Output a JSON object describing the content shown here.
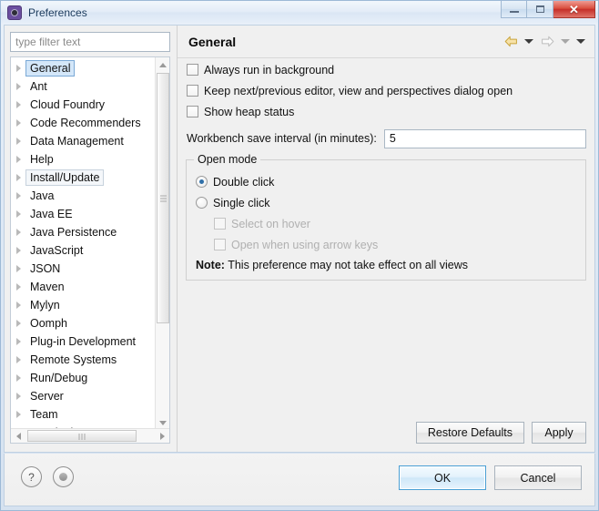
{
  "window": {
    "title": "Preferences",
    "icon": "preferences-gear-icon",
    "controls": {
      "minimize": "minimize-icon",
      "maximize": "maximize-icon",
      "close": "✕"
    }
  },
  "sidebar": {
    "filter": {
      "placeholder": "type filter text",
      "value": ""
    },
    "items": [
      {
        "label": "General",
        "state": "selected"
      },
      {
        "label": "Ant",
        "state": "normal"
      },
      {
        "label": "Cloud Foundry",
        "state": "normal"
      },
      {
        "label": "Code Recommenders",
        "state": "normal"
      },
      {
        "label": "Data Management",
        "state": "normal"
      },
      {
        "label": "Help",
        "state": "normal"
      },
      {
        "label": "Install/Update",
        "state": "hovered"
      },
      {
        "label": "Java",
        "state": "normal"
      },
      {
        "label": "Java EE",
        "state": "normal"
      },
      {
        "label": "Java Persistence",
        "state": "normal"
      },
      {
        "label": "JavaScript",
        "state": "normal"
      },
      {
        "label": "JSON",
        "state": "normal"
      },
      {
        "label": "Maven",
        "state": "normal"
      },
      {
        "label": "Mylyn",
        "state": "normal"
      },
      {
        "label": "Oomph",
        "state": "normal"
      },
      {
        "label": "Plug-in Development",
        "state": "normal"
      },
      {
        "label": "Remote Systems",
        "state": "normal"
      },
      {
        "label": "Run/Debug",
        "state": "normal"
      },
      {
        "label": "Server",
        "state": "normal"
      },
      {
        "label": "Team",
        "state": "normal"
      },
      {
        "label": "Terminal",
        "state": "normal"
      }
    ]
  },
  "page": {
    "title": "General",
    "nav": {
      "back": "back-arrow-icon",
      "back_menu": "chevron-down-icon",
      "forward": "forward-arrow-icon",
      "forward_menu": "chevron-down-icon",
      "view_menu": "chevron-down-icon"
    },
    "checkboxes": [
      {
        "label": "Always run in background",
        "checked": false,
        "enabled": true
      },
      {
        "label": "Keep next/previous editor, view and perspectives dialog open",
        "checked": false,
        "enabled": true
      },
      {
        "label": "Show heap status",
        "checked": false,
        "enabled": true
      }
    ],
    "save_interval": {
      "label": "Workbench save interval (in minutes):",
      "value": "5"
    },
    "open_mode": {
      "title": "Open mode",
      "options": [
        {
          "label": "Double click",
          "selected": true
        },
        {
          "label": "Single click",
          "selected": false
        }
      ],
      "sub_options": [
        {
          "label": "Select on hover",
          "checked": false,
          "enabled": false
        },
        {
          "label": "Open when using arrow keys",
          "checked": false,
          "enabled": false
        }
      ],
      "note_prefix": "Note:",
      "note_text": "This preference may not take effect on all views"
    },
    "buttons": {
      "restore_defaults": "Restore Defaults",
      "apply": "Apply"
    }
  },
  "footer": {
    "help_icon": "?",
    "status_icon": "oomph-recorder-icon",
    "ok": "OK",
    "cancel": "Cancel"
  }
}
